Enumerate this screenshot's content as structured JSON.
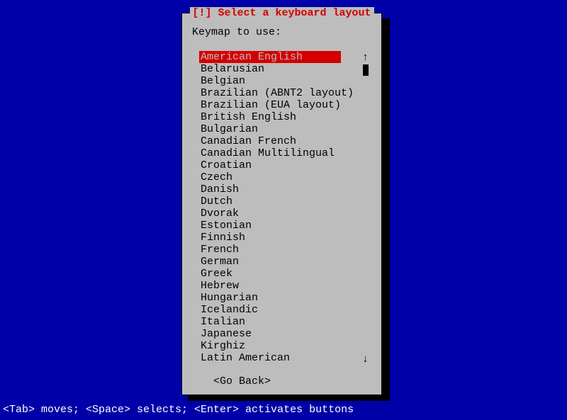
{
  "dialog": {
    "title": "[!] Select a keyboard layout",
    "prompt": "Keymap to use:",
    "selected_index": 0,
    "items": [
      "American English",
      "Belarusian",
      "Belgian",
      "Brazilian (ABNT2 layout)",
      "Brazilian (EUA layout)",
      "British English",
      "Bulgarian",
      "Canadian French",
      "Canadian Multilingual",
      "Croatian",
      "Czech",
      "Danish",
      "Dutch",
      "Dvorak",
      "Estonian",
      "Finnish",
      "French",
      "German",
      "Greek",
      "Hebrew",
      "Hungarian",
      "Icelandic",
      "Italian",
      "Japanese",
      "Kirghiz",
      "Latin American"
    ],
    "go_back": "<Go Back>",
    "scroll_up_glyph": "↑",
    "scroll_down_glyph": "↓"
  },
  "footer": {
    "help_text": "<Tab> moves; <Space> selects; <Enter> activates buttons"
  },
  "colors": {
    "background": "#0000a8",
    "dialog_bg": "#bdbdbd",
    "title_red": "#d40000",
    "selected_bg": "#d40000"
  }
}
